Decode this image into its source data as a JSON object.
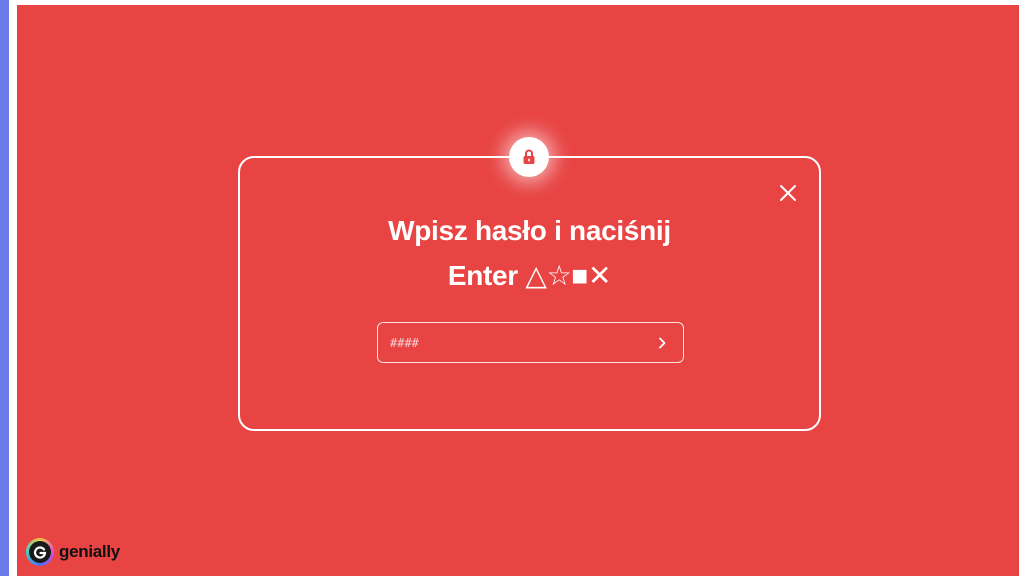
{
  "page": {
    "background_color": "#e84444",
    "accent_bar_color": "#6a7ce8"
  },
  "dialog": {
    "lock_icon": "lock-icon",
    "close_icon": "close-icon",
    "title_line1": "Wpisz hasło i naciśnij",
    "title_line2": "Enter △☆■✕",
    "input": {
      "placeholder": "####",
      "value": ""
    },
    "submit_icon": "chevron-right-icon"
  },
  "branding": {
    "logo_text": "genially"
  }
}
